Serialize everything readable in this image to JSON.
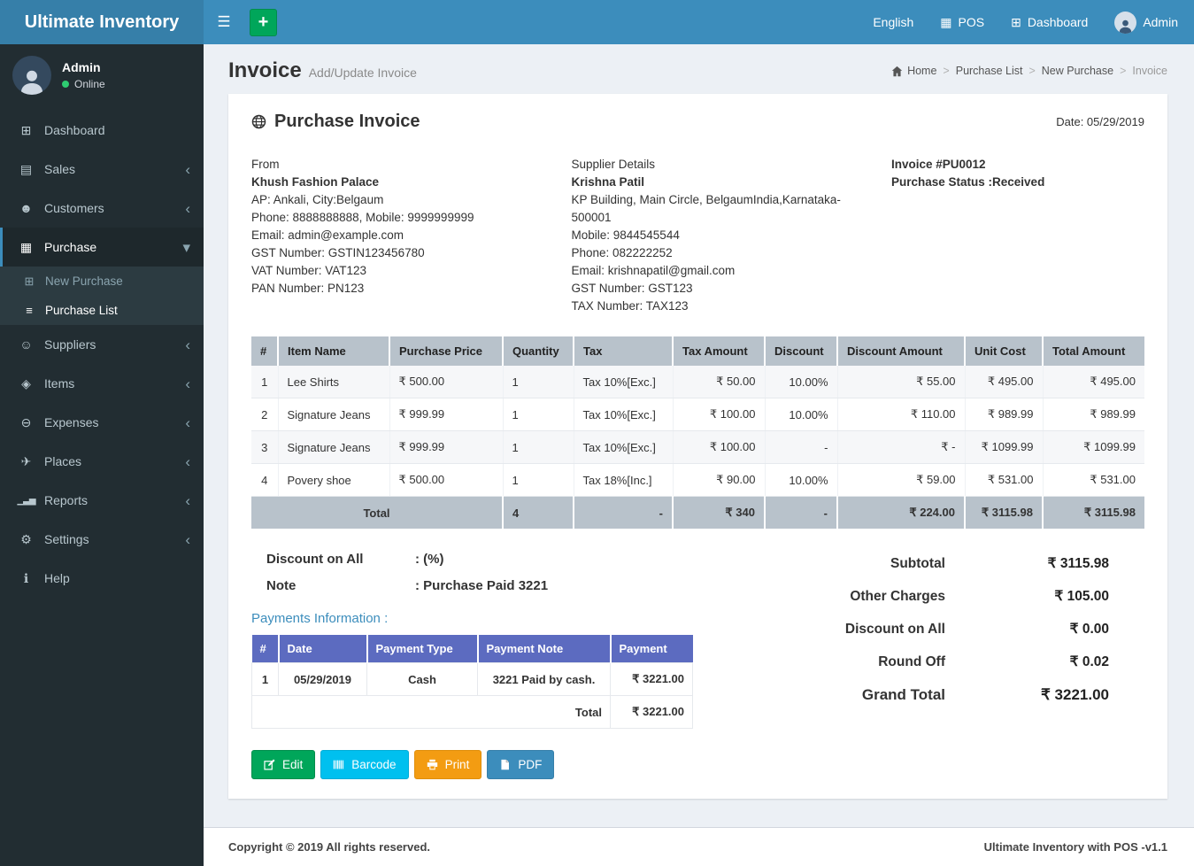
{
  "colors": {
    "navbar": "#3c8dbc",
    "logo_bg": "#367fa9",
    "sidebar_bg": "#222d32",
    "submenu_bg": "#2c3b41",
    "content_bg": "#ecf0f5",
    "table_header_bg": "#b8c2cb",
    "payments_header_bg": "#5c6bc0",
    "success": "#00a65a",
    "info": "#00c0ef",
    "warning": "#f39c12",
    "primary": "#3c8dbc"
  },
  "icons": {
    "hamburger": "☰",
    "add": "+",
    "pos": "▦",
    "dashboard_top": "⊞",
    "home": "⌂",
    "dashboard": "⊞",
    "sales": "▤",
    "customers": "☻",
    "purchase": "▦",
    "new_purchase": "⊞",
    "purchase_list": "≡",
    "suppliers": "☺",
    "items": "◈",
    "expenses": "⊖",
    "places": "✈",
    "reports": "▁▃▅",
    "settings": "⚙",
    "help": "ℹ",
    "chevron_left": "‹",
    "chevron_down": "▾"
  },
  "brand": {
    "title": "Ultimate Inventory"
  },
  "topbar": {
    "language": "English",
    "pos_label": "POS",
    "dashboard_label": "Dashboard",
    "user_label": "Admin"
  },
  "sidebar": {
    "user_name": "Admin",
    "user_status": "Online",
    "items": [
      {
        "label": "Dashboard"
      },
      {
        "label": "Sales"
      },
      {
        "label": "Customers"
      },
      {
        "label": "Purchase"
      },
      {
        "label": "Suppliers"
      },
      {
        "label": "Items"
      },
      {
        "label": "Expenses"
      },
      {
        "label": "Places"
      },
      {
        "label": "Reports"
      },
      {
        "label": "Settings"
      },
      {
        "label": "Help"
      }
    ],
    "submenu": [
      {
        "label": "New Purchase"
      },
      {
        "label": "Purchase List"
      }
    ]
  },
  "page": {
    "title": "Invoice",
    "subtitle": "Add/Update Invoice",
    "breadcrumb": [
      "Home",
      "Purchase List",
      "New Purchase",
      "Invoice"
    ]
  },
  "invoice": {
    "card_title": "Purchase Invoice",
    "date": "Date: 05/29/2019",
    "from": {
      "heading": "From",
      "name": "Khush Fashion Palace",
      "lines": [
        "AP: Ankali, City:Belgaum",
        "Phone: 8888888888, Mobile: 9999999999",
        "Email: admin@example.com",
        "GST Number: GSTIN123456780",
        "VAT Number: VAT123",
        "PAN Number: PN123"
      ]
    },
    "supplier": {
      "heading": "Supplier Details",
      "name": "Krishna Patil",
      "lines": [
        "KP Building, Main Circle, BelgaumIndia,Karnataka-500001",
        "Mobile: 9844545544",
        "Phone: 082222252",
        "Email: krishnapatil@gmail.com",
        "GST Number: GST123",
        "TAX Number: TAX123"
      ]
    },
    "meta": {
      "number": "Invoice #PU0012",
      "status": "Purchase Status :Received"
    },
    "items_table": {
      "headers": [
        "#",
        "Item Name",
        "Purchase Price",
        "Quantity",
        "Tax",
        "Tax Amount",
        "Discount",
        "Discount Amount",
        "Unit Cost",
        "Total Amount"
      ],
      "rows": [
        [
          "1",
          "Lee Shirts",
          "₹ 500.00",
          "1",
          "Tax 10%[Exc.]",
          "₹ 50.00",
          "10.00%",
          "₹ 55.00",
          "₹ 495.00",
          "₹ 495.00"
        ],
        [
          "2",
          "Signature Jeans",
          "₹ 999.99",
          "1",
          "Tax 10%[Exc.]",
          "₹ 100.00",
          "10.00%",
          "₹ 110.00",
          "₹ 989.99",
          "₹ 989.99"
        ],
        [
          "3",
          "Signature Jeans",
          "₹ 999.99",
          "1",
          "Tax 10%[Exc.]",
          "₹ 100.00",
          "-",
          "₹ -",
          "₹ 1099.99",
          "₹ 1099.99"
        ],
        [
          "4",
          "Povery shoe",
          "₹ 500.00",
          "1",
          "Tax 18%[Inc.]",
          "₹ 90.00",
          "10.00%",
          "₹ 59.00",
          "₹ 531.00",
          "₹ 531.00"
        ]
      ],
      "total": {
        "label": "Total",
        "qty": "4",
        "tax": "-",
        "tax_amount": "₹ 340",
        "discount": "-",
        "discount_amount": "₹ 224.00",
        "unit_cost": "₹ 3115.98",
        "total_amount": "₹ 3115.98"
      }
    },
    "discount_label": "Discount on All",
    "discount_value": ": (%)",
    "note_label": "Note",
    "note_value": ": Purchase Paid 3221",
    "payments": {
      "title": "Payments Information :",
      "headers": [
        "#",
        "Date",
        "Payment Type",
        "Payment Note",
        "Payment"
      ],
      "rows": [
        [
          "1",
          "05/29/2019",
          "Cash",
          "3221 Paid by cash.",
          "₹ 3221.00"
        ]
      ],
      "total_label": "Total",
      "total_value": "₹ 3221.00"
    },
    "summary": [
      {
        "label": "Subtotal",
        "value": "₹ 3115.98"
      },
      {
        "label": "Other Charges",
        "value": "₹ 105.00"
      },
      {
        "label": "Discount on All",
        "value": "₹ 0.00"
      },
      {
        "label": "Round Off",
        "value": "₹ 0.02"
      },
      {
        "label": "Grand Total",
        "value": "₹ 3221.00"
      }
    ],
    "buttons": [
      {
        "label": "Edit"
      },
      {
        "label": "Barcode"
      },
      {
        "label": "Print"
      },
      {
        "label": "PDF"
      }
    ]
  },
  "footer": {
    "left": "Copyright © 2019 All rights reserved.",
    "right": "Ultimate Inventory with POS -v1.1"
  }
}
